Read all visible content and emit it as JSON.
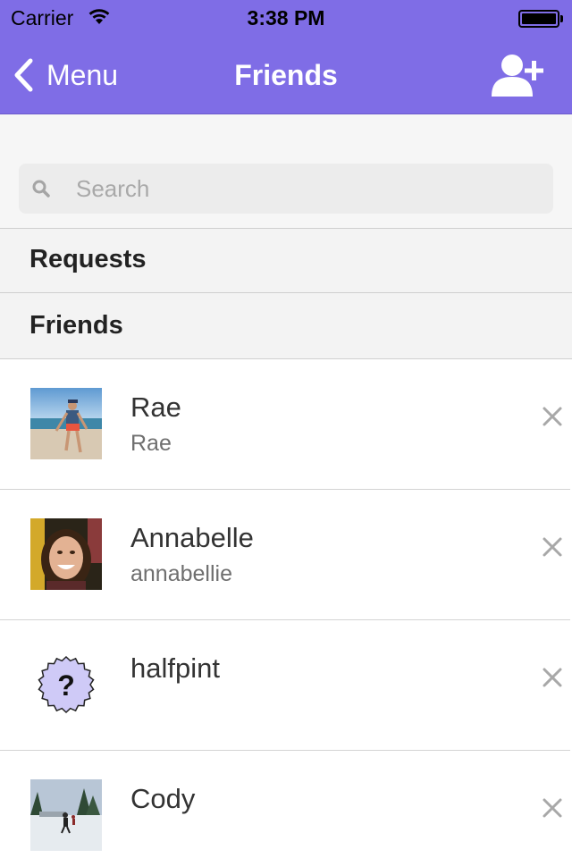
{
  "status_bar": {
    "carrier": "Carrier",
    "time": "3:38 PM",
    "wifi_icon": "wifi-icon",
    "battery_icon": "battery-icon"
  },
  "nav": {
    "back_label": "Menu",
    "back_icon": "chevron-left-icon",
    "title": "Friends",
    "add_icon": "add-friend-icon"
  },
  "search": {
    "placeholder": "Search",
    "icon": "search-icon"
  },
  "sections": {
    "requests": "Requests",
    "friends": "Friends"
  },
  "friends": [
    {
      "name": "Rae",
      "username": "Rae",
      "avatar": "beach-photo"
    },
    {
      "name": "Annabelle",
      "username": "annabellie",
      "avatar": "portrait-photo"
    },
    {
      "name": "halfpint",
      "username": "",
      "avatar": "question-mark-badge"
    },
    {
      "name": "Cody",
      "username": "",
      "avatar": "snow-photo"
    }
  ],
  "colors": {
    "nav_background": "#7f6de6",
    "nav_text": "#ffffff",
    "remove_icon": "#a8a8a8"
  }
}
